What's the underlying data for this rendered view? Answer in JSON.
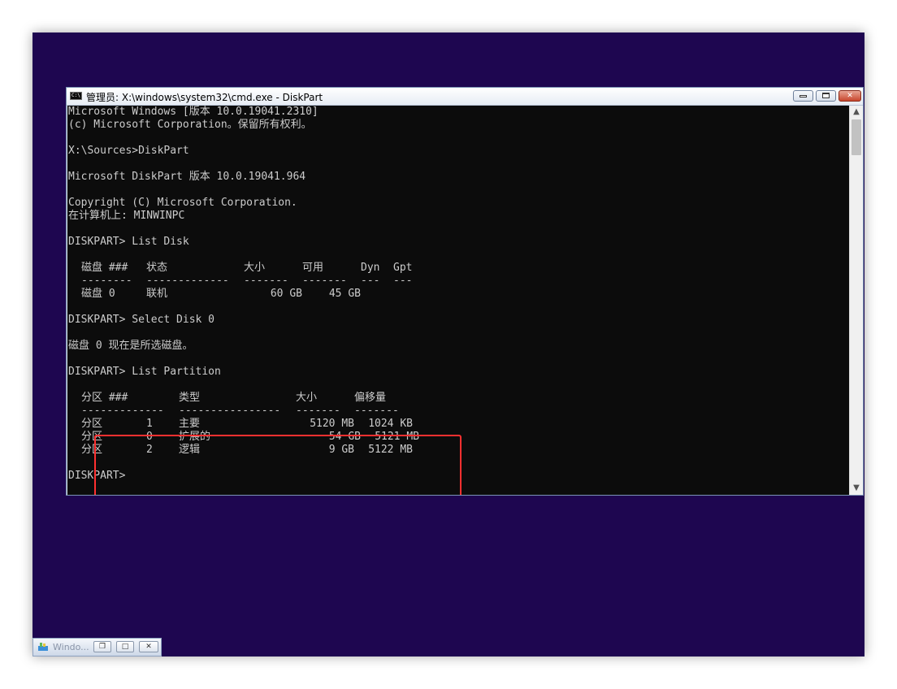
{
  "window": {
    "title": "管理员: X:\\windows\\system32\\cmd.exe - DiskPart",
    "icon_text": "C:\\",
    "icon": "console-icon",
    "minimize_icon": "minimize-icon",
    "maximize_icon": "maximize-icon",
    "close_label": "✕"
  },
  "console": {
    "lines": [
      "Microsoft Windows [版本 10.0.19041.2310]",
      "(c) Microsoft Corporation。保留所有权利。",
      "",
      "X:\\Sources>DiskPart",
      "",
      "Microsoft DiskPart 版本 10.0.19041.964",
      "",
      "Copyright (C) Microsoft Corporation.",
      "在计算机上: MINWINPC",
      "",
      "DISKPART> List Disk",
      "",
      "",
      "",
      "",
      "",
      "DISKPART> Select Disk 0",
      "",
      "磁盘 0 现在是所选磁盘。",
      "",
      "DISKPART> List Partition",
      "",
      "",
      "",
      "",
      "",
      "",
      "",
      "DISKPART>"
    ],
    "disk_table": {
      "headers": [
        "磁盘 ###",
        "状态",
        "大小",
        "可用",
        "Dyn",
        "Gpt"
      ],
      "separators": [
        "--------",
        "-------------",
        "-------",
        "-------",
        "---",
        "---"
      ],
      "rows": [
        [
          "磁盘 0",
          "联机",
          "60 GB",
          "45 GB",
          "",
          ""
        ]
      ]
    },
    "partition_table": {
      "headers": [
        "分区 ###",
        "类型",
        "大小",
        "偏移量"
      ],
      "separators": [
        "-------------",
        "----------------",
        "-------",
        "-------"
      ],
      "rows": [
        [
          "分区",
          "1",
          "主要",
          "5120 MB",
          "1024 KB"
        ],
        [
          "分区",
          "0",
          "扩展的",
          "54 GB",
          "5121 MB"
        ],
        [
          "分区",
          "2",
          "逻辑",
          "9 GB",
          "5122 MB"
        ]
      ]
    }
  },
  "scrollbar": {
    "up_arrow": "▲",
    "down_arrow": "▼"
  },
  "taskbar": {
    "label": "Windo...",
    "icon": "setup-icon",
    "restore_label": "❐",
    "maximize_label": "□",
    "close_label": "✕"
  },
  "colors": {
    "desktop": "#1e0650",
    "console_bg": "#0c0c0c",
    "console_fg": "#cccccc",
    "highlight": "#ff3030"
  }
}
